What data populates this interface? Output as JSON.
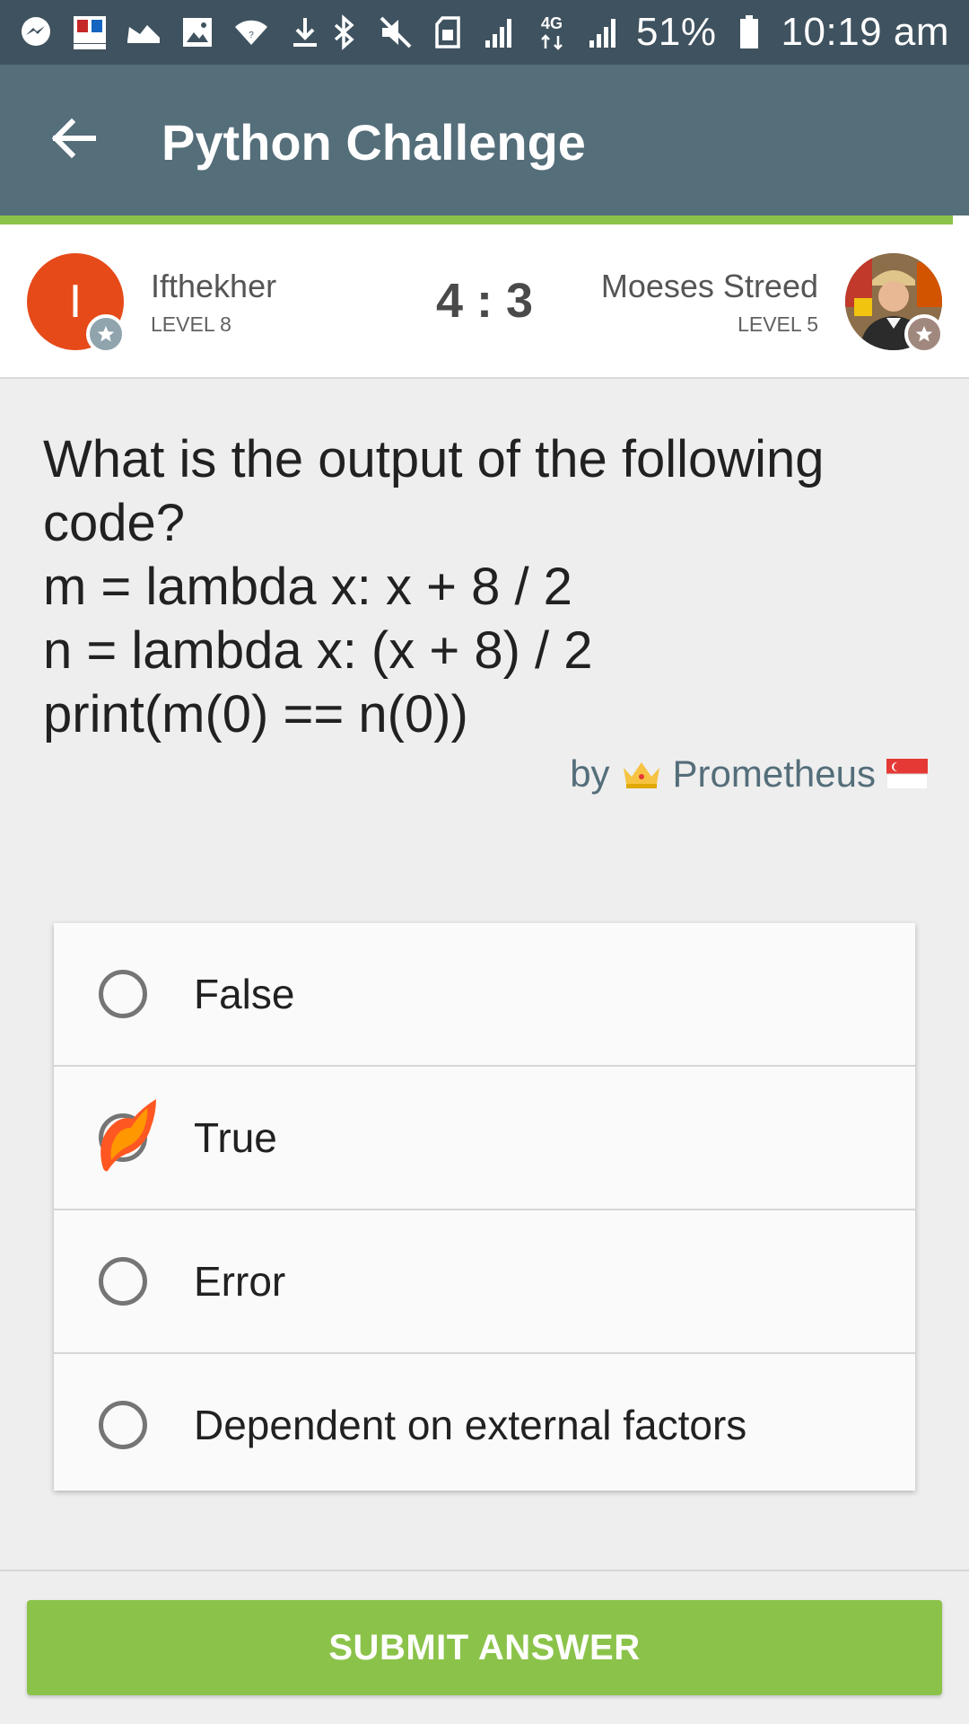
{
  "status_bar": {
    "left_icons": [
      "messenger-icon",
      "app-icon",
      "shoe-icon",
      "image-icon",
      "wifi-icon",
      "download-icon"
    ],
    "right_icons": [
      "bluetooth-icon",
      "mute-icon",
      "sim-icon",
      "signal-icon",
      "4g-signal-icon",
      "signal-icon"
    ],
    "network_type": "4G",
    "battery": "51%",
    "time": "10:19 am"
  },
  "header": {
    "title": "Python Challenge",
    "back_icon": "arrow-left-icon"
  },
  "match": {
    "player_left": {
      "initial": "I",
      "name": "Ifthekher",
      "level": "LEVEL 8"
    },
    "score": "4 : 3",
    "player_right": {
      "name": "Moeses Streed",
      "level": "LEVEL 5"
    }
  },
  "question": {
    "lines": [
      "What is the output of the following",
      "code?",
      "m = lambda x: x + 8 / 2",
      "n = lambda x: (x + 8) / 2",
      "print(m(0) == n(0))"
    ],
    "author_prefix": "by",
    "author_name": "Prometheus",
    "author_badge_icon": "crown-icon",
    "author_flag_icon": "singapore-flag-icon"
  },
  "options": [
    {
      "label": "False",
      "selected": false
    },
    {
      "label": "True",
      "selected": true
    },
    {
      "label": "Error",
      "selected": false
    },
    {
      "label": "Dependent on external factors",
      "selected": false
    }
  ],
  "submit_label": "SUBMIT ANSWER",
  "colors": {
    "status_bar": "#3f525f",
    "app_bar": "#546e7a",
    "accent_green": "#8bc34a",
    "avatar_left": "#e64a19",
    "selected_flame": "#ff5722"
  }
}
